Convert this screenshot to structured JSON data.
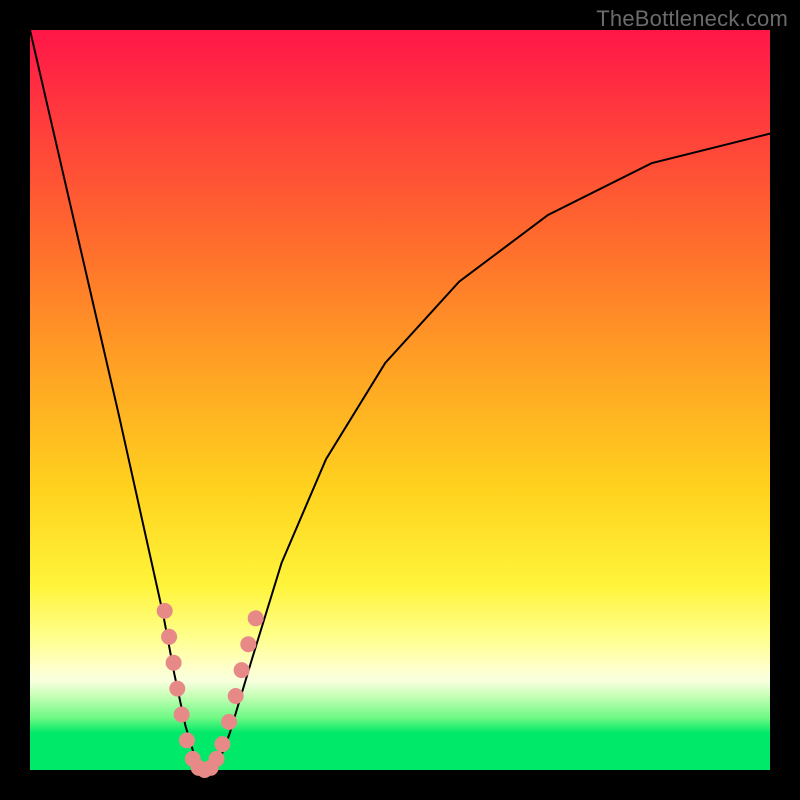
{
  "watermark": "TheBottleneck.com",
  "colors": {
    "frame": "#000000",
    "dot": "#e78a87",
    "curve": "#000000"
  },
  "chart_data": {
    "type": "line",
    "title": "",
    "xlabel": "",
    "ylabel": "",
    "xlim": [
      0,
      100
    ],
    "ylim": [
      0,
      100
    ],
    "grid": false,
    "legend": false,
    "note": "No axis ticks or labels are visible in the image; values below are estimated from pixel positions on a 0–100 relative scale.",
    "series": [
      {
        "name": "curve",
        "x": [
          0,
          3,
          6,
          9,
          12,
          14,
          16,
          18,
          19.5,
          21,
          22.5,
          24,
          25.5,
          27,
          30,
          34,
          40,
          48,
          58,
          70,
          84,
          100
        ],
        "y": [
          100,
          87,
          74,
          61,
          48,
          39,
          30,
          21,
          13,
          6,
          1,
          0,
          1,
          5,
          15,
          28,
          42,
          55,
          66,
          75,
          82,
          86
        ]
      }
    ],
    "markers": [
      {
        "x": 18.2,
        "y": 21.5
      },
      {
        "x": 18.8,
        "y": 18.0
      },
      {
        "x": 19.4,
        "y": 14.5
      },
      {
        "x": 19.9,
        "y": 11.0
      },
      {
        "x": 20.5,
        "y": 7.5
      },
      {
        "x": 21.2,
        "y": 4.0
      },
      {
        "x": 22.0,
        "y": 1.5
      },
      {
        "x": 22.8,
        "y": 0.3
      },
      {
        "x": 23.6,
        "y": 0.0
      },
      {
        "x": 24.4,
        "y": 0.3
      },
      {
        "x": 25.2,
        "y": 1.5
      },
      {
        "x": 26.0,
        "y": 3.5
      },
      {
        "x": 26.9,
        "y": 6.5
      },
      {
        "x": 27.8,
        "y": 10.0
      },
      {
        "x": 28.6,
        "y": 13.5
      },
      {
        "x": 29.5,
        "y": 17.0
      },
      {
        "x": 30.5,
        "y": 20.5
      }
    ]
  }
}
